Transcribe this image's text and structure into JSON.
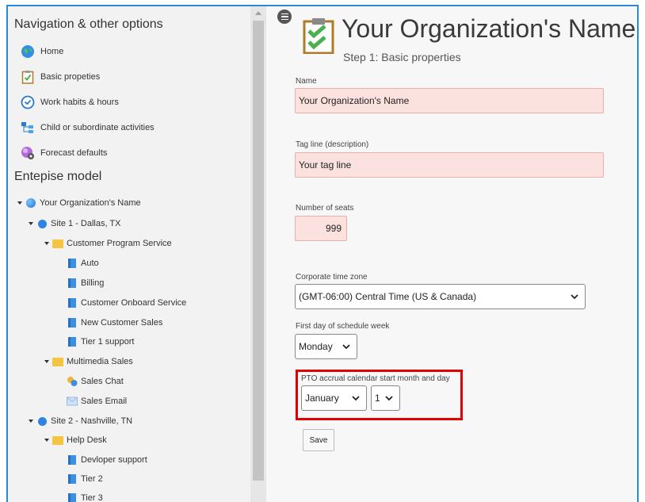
{
  "sidebar": {
    "nav_title": "Navigation & other options",
    "nav_items": [
      {
        "label": "Home",
        "icon": "globe-icon"
      },
      {
        "label": "Basic propeties",
        "icon": "clipboard-check-icon"
      },
      {
        "label": "Work habits & hours",
        "icon": "clock-icon"
      },
      {
        "label": "Child or subordinate activities",
        "icon": "hierarchy-icon"
      },
      {
        "label": "Forecast defaults",
        "icon": "forecast-icon"
      }
    ],
    "model_title": "Entepise model",
    "tree": {
      "org": "Your Organization's Name",
      "site1": "Site 1 - Dallas, TX",
      "cps": "Customer Program Service",
      "auto": "Auto",
      "billing": "Billing",
      "onboard": "Customer Onboard Service",
      "newsales": "New Customer Sales",
      "tier1": "Tier 1 support",
      "multimedia": "Multimedia Sales",
      "saleschat": "Sales Chat",
      "salesemail": "Sales Email",
      "site2": "Site 2 - Nashville, TN",
      "helpdesk": "Help Desk",
      "devsupport": "Devloper support",
      "tier2": "Tier 2",
      "tier3": "Tier 3"
    }
  },
  "main": {
    "title": "Your Organization's Name",
    "subtitle": "Step 1: Basic properties",
    "name_label": "Name",
    "name_value": "Your Organization's Name",
    "tagline_label": "Tag line (description)",
    "tagline_value": "Your tag line",
    "seats_label": "Number of seats",
    "seats_value": "999",
    "timezone_label": "Corporate time zone",
    "timezone_value": "(GMT-06:00) Central Time (US & Canada)",
    "firstday_label": "First day of schedule week",
    "firstday_value": "Monday",
    "pto_label": "PTO accrual calendar start month and day",
    "pto_month": "January",
    "pto_day": "1",
    "save_label": "Save"
  },
  "colors": {
    "frame_border": "#2b8ad8",
    "highlight": "#e00000",
    "input_bg": "#fbe2de"
  }
}
